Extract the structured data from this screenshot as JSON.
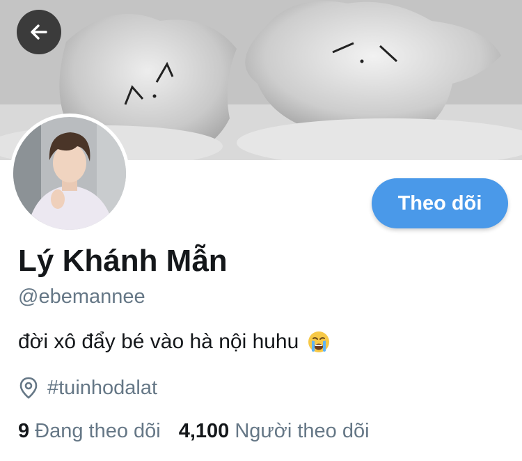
{
  "profile": {
    "display_name": "Lý Khánh Mẫn",
    "handle": "@ebemannee",
    "bio": "đời xô đẩy bé vào hà nội huhu",
    "bio_emoji": "loudly-crying-face",
    "location": "#tuinhodalat",
    "following_count": "9",
    "following_label": "Đang theo dõi",
    "followers_count": "4,100",
    "followers_label": "Người theo dõi"
  },
  "actions": {
    "follow_label": "Theo dõi",
    "back_icon": "arrow-left-icon"
  },
  "colors": {
    "accent": "#4a99e9",
    "text_primary": "#14171a",
    "text_secondary": "#657786"
  }
}
